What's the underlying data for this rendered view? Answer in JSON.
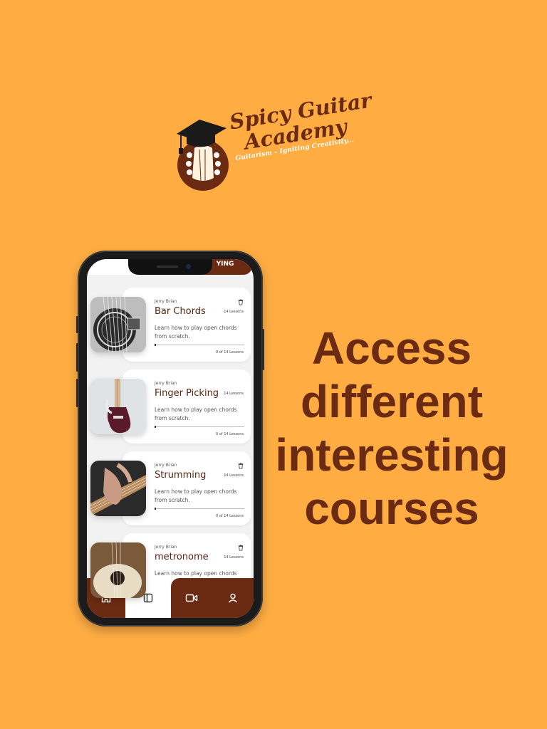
{
  "logo": {
    "line1": "Spicy Guitar",
    "line2": "Academy",
    "tagline": "Guitarism - Igniting Creativity..."
  },
  "headline": {
    "lines": [
      "Access",
      "different",
      "interesting",
      "courses"
    ]
  },
  "app": {
    "top_tab_label": "YING",
    "courses": [
      {
        "author": "Jerry Brian",
        "title": "Bar Chords",
        "lessons": "14 Lessons",
        "description": "Learn how to play open chords from scratch.",
        "progress_label": "0 of 14 Lessons",
        "progress": 0.01,
        "image": "guitar-soundhole-photo"
      },
      {
        "author": "Jerry Brian",
        "title": "Finger Picking",
        "lessons": "14 Lessons",
        "description": "Learn how to play open chords from scratch.",
        "progress_label": "0 of 14 Lessons",
        "progress": 0.01,
        "image": "electric-guitar-photo"
      },
      {
        "author": "Jerry Brian",
        "title": "Strumming",
        "lessons": "14 Lessons",
        "description": "Learn how to play open chords from scratch.",
        "progress_label": "0 of 14 Lessons",
        "progress": 0.01,
        "image": "hand-on-fretboard-photo"
      },
      {
        "author": "Jerry Brian",
        "title": "metronome",
        "lessons": "14 Lessons",
        "description": "Learn how to play open chords",
        "image": "acoustic-guitar-photo"
      }
    ],
    "nav": [
      {
        "icon": "home-icon",
        "active": false
      },
      {
        "icon": "courses-icon",
        "active": true
      },
      {
        "icon": "video-icon",
        "active": false
      },
      {
        "icon": "user-icon",
        "active": false
      }
    ]
  },
  "colors": {
    "background": "#FFAD43",
    "brand_brown": "#6B2A12"
  }
}
